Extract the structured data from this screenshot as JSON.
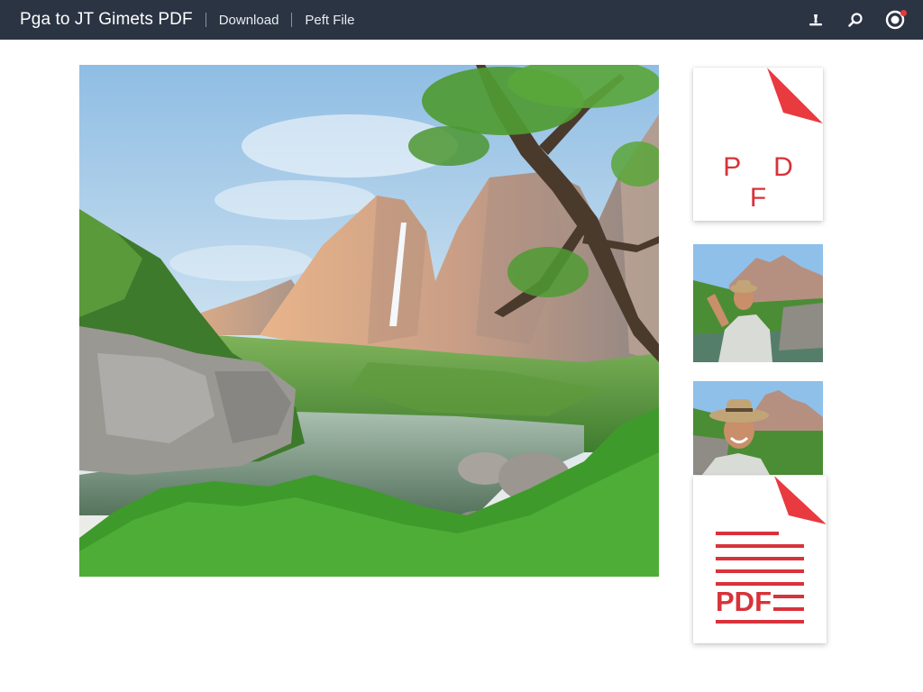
{
  "header": {
    "title": "Pga to JT Gimets PDF",
    "links": [
      "Download",
      "Peft File"
    ],
    "icons": [
      "upload-icon",
      "search-icon",
      "profile-icon"
    ]
  },
  "main_image": {
    "alt": "Mountain landscape with waterfall, lake and tree"
  },
  "sidebar": {
    "pdf_card_top": {
      "label": "P D F"
    },
    "thumbnails": [
      {
        "alt": "Man in hat at mountain lake"
      },
      {
        "alt": "Smiling man in hat by mountains"
      }
    ],
    "pdf_card_bottom": {
      "label": "PDF"
    }
  },
  "colors": {
    "topbar": "#2b3443",
    "pdf_red": "#d8323a",
    "notification_dot": "#e5393a"
  }
}
